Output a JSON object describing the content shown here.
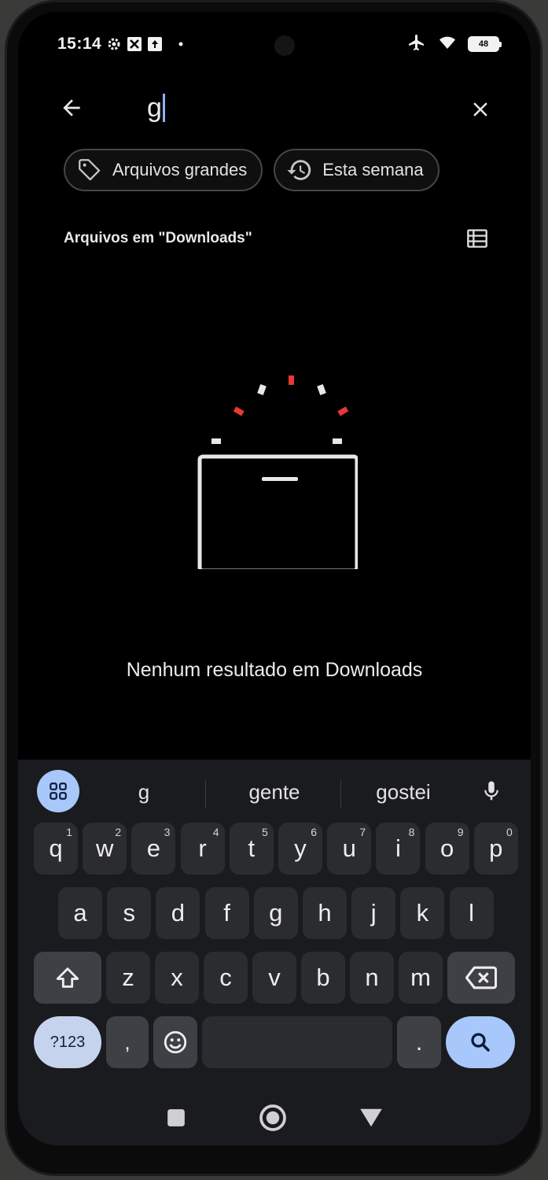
{
  "status_bar": {
    "time": "15:14",
    "battery_level": "48",
    "icons": [
      "settings-gear-icon",
      "sync-tile-icon",
      "upload-box-icon",
      "notification-dot-icon",
      "airplane-mode-icon",
      "wifi-icon",
      "battery-icon"
    ]
  },
  "search": {
    "query": "g",
    "back_icon": "arrow-left-icon",
    "clear_icon": "close-icon"
  },
  "chips": [
    {
      "label": "Arquivos grandes",
      "icon": "tag-icon"
    },
    {
      "label": "Esta semana",
      "icon": "history-icon"
    }
  ],
  "section": {
    "title": "Arquivos em \"Downloads\"",
    "view_toggle_icon": "list-view-icon"
  },
  "empty_state": {
    "message": "Nenhum resultado em Downloads",
    "accent_color": "#e53935"
  },
  "keyboard": {
    "suggestions": [
      "g",
      "gente",
      "gostei"
    ],
    "row1": [
      {
        "k": "q",
        "n": "1"
      },
      {
        "k": "w",
        "n": "2"
      },
      {
        "k": "e",
        "n": "3"
      },
      {
        "k": "r",
        "n": "4"
      },
      {
        "k": "t",
        "n": "5"
      },
      {
        "k": "y",
        "n": "6"
      },
      {
        "k": "u",
        "n": "7"
      },
      {
        "k": "i",
        "n": "8"
      },
      {
        "k": "o",
        "n": "9"
      },
      {
        "k": "p",
        "n": "0"
      }
    ],
    "row2": [
      "a",
      "s",
      "d",
      "f",
      "g",
      "h",
      "j",
      "k",
      "l"
    ],
    "row3": [
      "z",
      "x",
      "c",
      "v",
      "b",
      "n",
      "m"
    ],
    "symbols_label": "?123",
    "comma_label": ",",
    "period_label": "."
  },
  "colors": {
    "background": "#000000",
    "accent_blue": "#a8c7fa",
    "key": "#2b2c30"
  }
}
